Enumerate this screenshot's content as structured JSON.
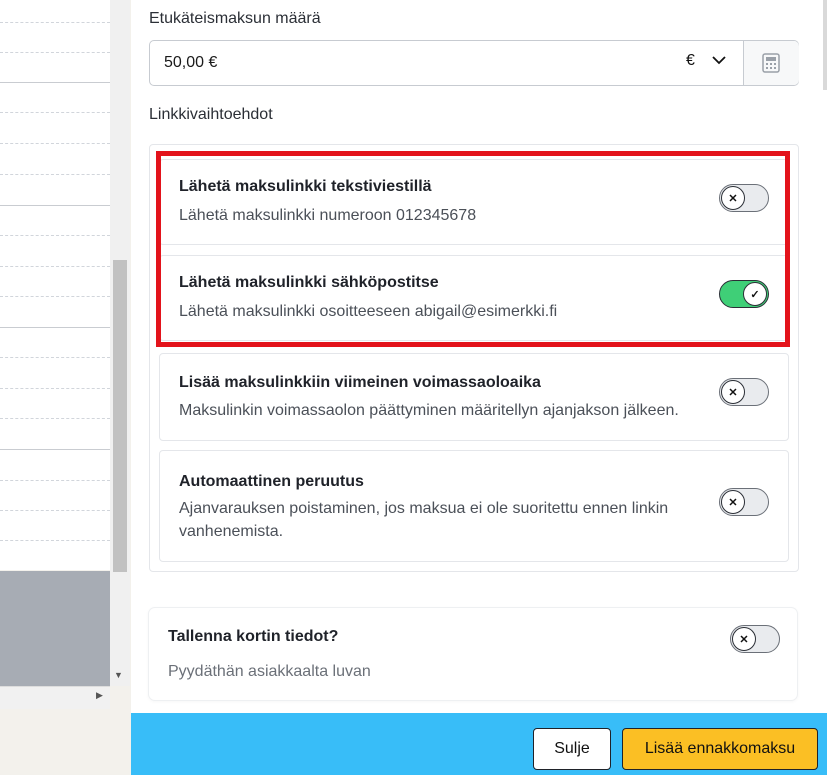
{
  "panel": {
    "amount_label": "Etukäteismaksun määrä",
    "amount_value": "50,00 €",
    "currency": "€",
    "link_options_label": "Linkkivaihtoehdot"
  },
  "options": [
    {
      "title": "Lähetä maksulinkki tekstiviestillä",
      "desc": "Lähetä maksulinkki numeroon 012345678",
      "enabled": false
    },
    {
      "title": "Lähetä maksulinkki sähköpostitse",
      "desc": "Lähetä maksulinkki osoitteeseen abigail@esimerkki.fi",
      "enabled": true
    },
    {
      "title": "Lisää maksulinkkiin viimeinen voimassaoloaika",
      "desc": "Maksulinkin voimassaolon päättyminen määritellyn ajanjakson jälkeen.",
      "enabled": false
    },
    {
      "title": "Automaattinen peruutus",
      "desc_line1": "Ajanvarauksen poistaminen, jos maksua ei ole suoritettu ennen linkin",
      "desc_line2": "vanhenemista.",
      "enabled": false
    }
  ],
  "save_card": {
    "title": "Tallenna kortin tiedot?",
    "desc": "Pyydäthän asiakkaalta luvan",
    "enabled": false
  },
  "footer": {
    "close_label": "Sulje",
    "add_label": "Lisää ennakkomaksu"
  },
  "icons": {
    "toggle_off": "✕",
    "toggle_on": "✓",
    "calculator": "calculator-icon",
    "chevron": "chevron-down-icon"
  },
  "colors": {
    "footer": "#38bdf8",
    "primary_button": "#fbbf24",
    "toggle_on": "#3fcf77",
    "highlight": "#e3131b"
  }
}
